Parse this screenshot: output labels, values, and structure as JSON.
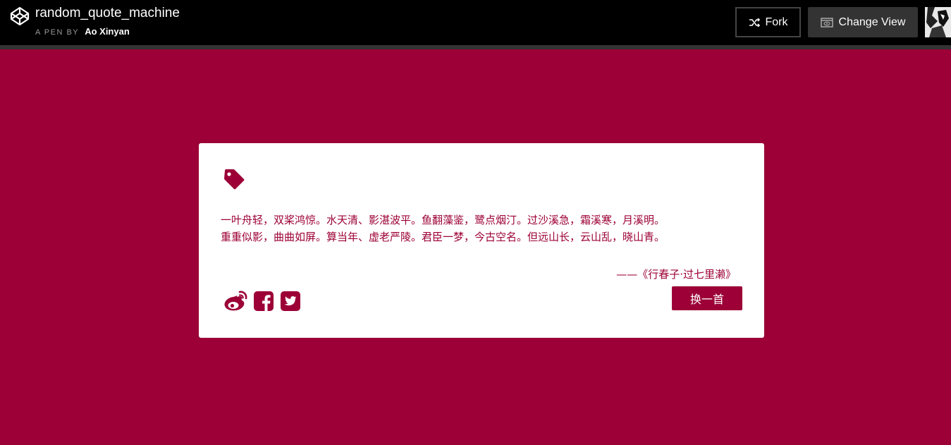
{
  "header": {
    "pen_title": "random_quote_machine",
    "pen_by_label": "A PEN BY",
    "author": "Ao Xinyan",
    "fork_label": "Fork",
    "change_view_label": "Change View"
  },
  "quote": {
    "lines": [
      "一叶舟轻，双桨鸿惊。水天清、影湛波平。鱼翻藻鉴，鹭点烟汀。过沙溪急，霜溪寒，月溪明。",
      "重重似影，曲曲如屏。算当年、虚老严陵。君臣一梦，今古空名。但远山长，云山乱，晓山青。"
    ],
    "author": "——《行春子·过七里濑》",
    "new_quote_label": "换一首"
  },
  "share_icons": [
    "weibo-icon",
    "facebook-icon",
    "twitter-icon"
  ],
  "colors": {
    "accent": "#9c0036",
    "topbar": "#000000",
    "card": "#ffffff"
  }
}
